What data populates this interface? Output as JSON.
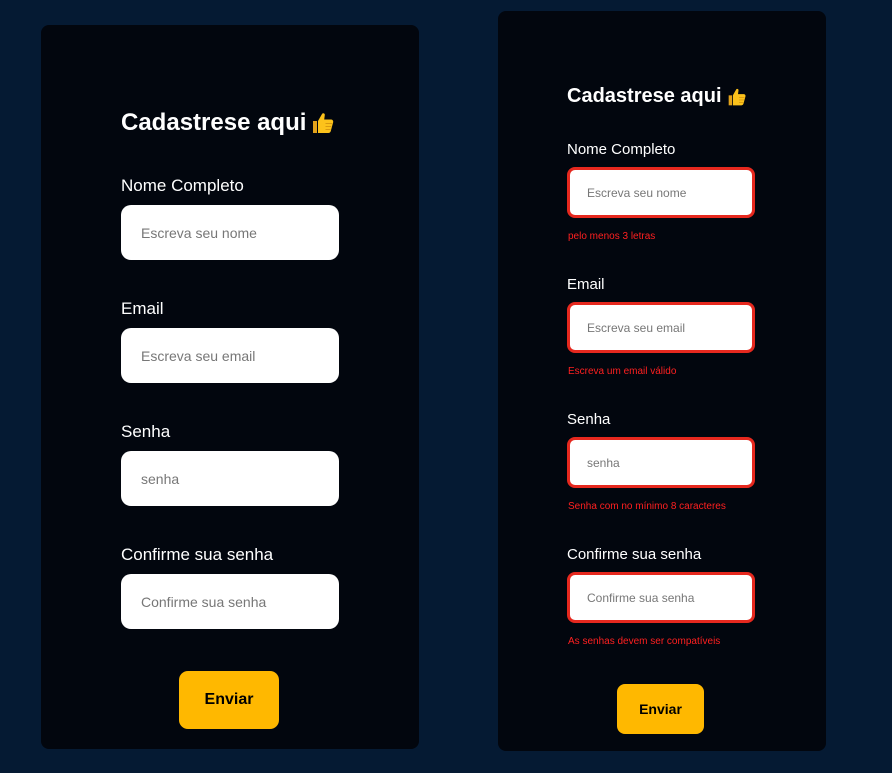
{
  "colors": {
    "page_background": "#051a33",
    "card_background": "#02060e",
    "button": "#ffb800",
    "error": "#ff2020",
    "error_border": "#e6281e"
  },
  "left_form": {
    "title": "Cadastrese aqui",
    "title_icon": "thumbs-up-icon",
    "fields": {
      "name": {
        "label": "Nome Completo",
        "placeholder": "Escreva seu nome",
        "value": ""
      },
      "email": {
        "label": "Email",
        "placeholder": "Escreva seu email",
        "value": ""
      },
      "password": {
        "label": "Senha",
        "placeholder": "senha",
        "value": ""
      },
      "confirm": {
        "label": "Confirme sua senha",
        "placeholder": "Confirme sua senha",
        "value": ""
      }
    },
    "submit_label": "Enviar"
  },
  "right_form": {
    "title": "Cadastrese aqui",
    "title_icon": "thumbs-up-icon",
    "fields": {
      "name": {
        "label": "Nome Completo",
        "placeholder": "Escreva seu nome",
        "value": "",
        "error": "pelo menos 3 letras"
      },
      "email": {
        "label": "Email",
        "placeholder": "Escreva seu email",
        "value": "",
        "error": "Escreva um email válido"
      },
      "password": {
        "label": "Senha",
        "placeholder": "senha",
        "value": "",
        "error": "Senha com no mínimo 8 caracteres"
      },
      "confirm": {
        "label": "Confirme sua senha",
        "placeholder": "Confirme sua senha",
        "value": "",
        "error": "As senhas devem ser compatíveis"
      }
    },
    "submit_label": "Enviar"
  }
}
